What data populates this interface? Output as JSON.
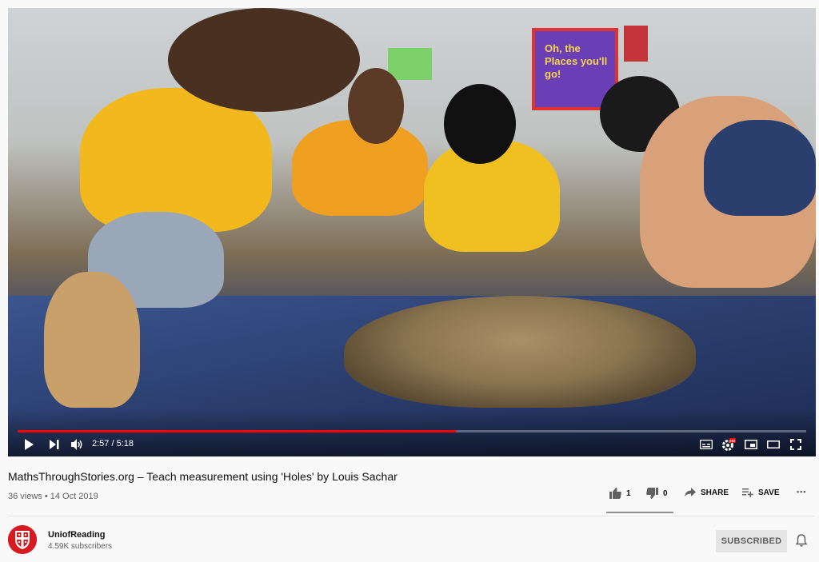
{
  "player": {
    "current_time": "2:57",
    "duration": "5:18",
    "time_separator": " / ",
    "progress_fraction": 0.556,
    "poster_text": "Oh, the Places you'll go!",
    "colors": {
      "progress": "#ff0000"
    },
    "icons": [
      "play-icon",
      "next-icon",
      "volume-icon",
      "subtitles-icon",
      "settings-icon",
      "miniplayer-icon",
      "theater-icon",
      "fullscreen-icon"
    ],
    "hd_badge": "HD"
  },
  "video": {
    "title": "MathsThroughStories.org – Teach measurement using 'Holes' by Louis Sachar",
    "views": "36 views",
    "separator": " • ",
    "date": "14 Oct 2019"
  },
  "actions": {
    "likes": "1",
    "dislikes": "0",
    "share_label": "SHARE",
    "save_label": "SAVE",
    "more_label": "•••"
  },
  "channel": {
    "name": "UniofReading",
    "subscribers": "4.59K subscribers",
    "subscribe_label": "SUBSCRIBED",
    "avatar_color": "#d71920"
  }
}
